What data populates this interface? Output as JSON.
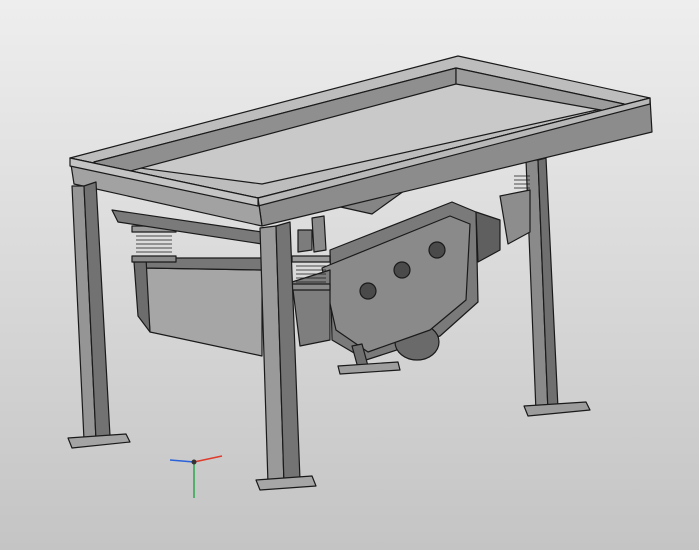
{
  "viewport": {
    "background_top": "#eeeeee",
    "background_bottom": "#c4c4c4"
  },
  "model": {
    "type": "vibrating screen feeder assembly",
    "render_style": "shaded with black edges",
    "color_light": "#a9a9a9",
    "color_mid": "#8e8e8e",
    "color_dark": "#6e6e6e",
    "color_edge": "#1a1a1a"
  },
  "triad": {
    "x_color": "#e03a2a",
    "y_color": "#2aa84a",
    "z_color": "#2a62d9"
  }
}
